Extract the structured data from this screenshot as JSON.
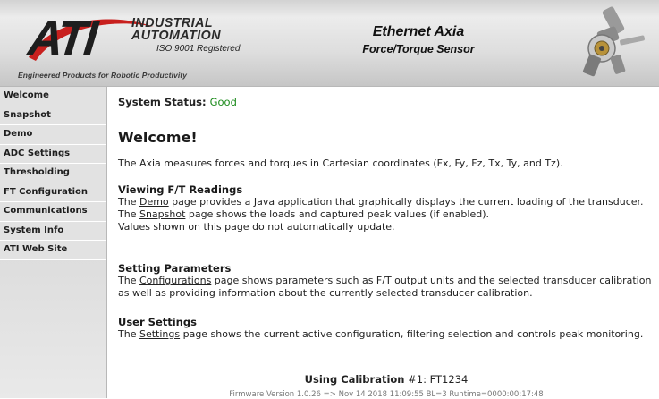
{
  "header": {
    "logo_text": "ATI",
    "company_line1": "INDUSTRIAL",
    "company_line2": "AUTOMATION",
    "iso": "ISO 9001 Registered",
    "tagline": "Engineered Products for Robotic Productivity",
    "product_line1": "Ethernet Axia",
    "product_line2": "Force/Torque Sensor"
  },
  "sidebar": {
    "items": [
      {
        "label": "Welcome"
      },
      {
        "label": "Snapshot"
      },
      {
        "label": "Demo"
      },
      {
        "label": "ADC Settings"
      },
      {
        "label": "Thresholding"
      },
      {
        "label": "FT Configuration"
      },
      {
        "label": "Communications"
      },
      {
        "label": "System Info"
      },
      {
        "label": "ATI Web Site"
      }
    ]
  },
  "main": {
    "status_label": "System Status:",
    "status_value": "Good",
    "title": "Welcome!",
    "intro": "The Axia measures forces and torques in Cartesian coordinates (Fx, Fy, Fz, Tx, Ty, and Tz).",
    "sections": [
      {
        "heading": "Viewing F/T Readings",
        "p1_pre": "The ",
        "p1_link": "Demo",
        "p1_post": " page provides a Java application that graphically displays the current loading of the transducer.",
        "p2_pre": "The ",
        "p2_link": "Snapshot",
        "p2_post": " page shows the loads and captured peak values (if enabled).",
        "p3": "Values shown on this page do not automatically update."
      },
      {
        "heading": "Setting Parameters",
        "p1_pre": "The ",
        "p1_link": "Configurations",
        "p1_post": " page shows parameters such as F/T output units and the selected transducer calibration as well as providing information about the currently selected transducer calibration."
      },
      {
        "heading": "User Settings",
        "p1_pre": "The ",
        "p1_link": "Settings",
        "p1_post": " page shows the current active configuration, filtering selection and controls peak monitoring."
      }
    ],
    "calibration_label": "Using Calibration",
    "calibration_value": "#1: FT1234",
    "firmware": "Firmware Version 1.0.26 => Nov 14 2018 11:09:55 BL=3 Runtime=0000:00:17:48"
  },
  "colors": {
    "status_good": "#1e8c1e",
    "logo_swoosh": "#c8201e",
    "sidebar_bg": "#e2e2e2"
  }
}
